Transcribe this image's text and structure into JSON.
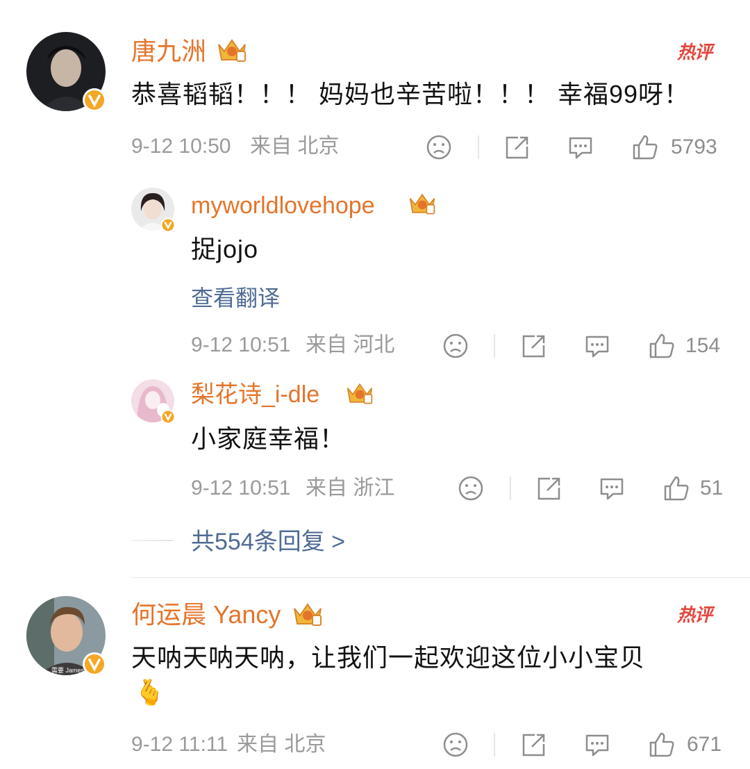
{
  "comments": [
    {
      "username": "唐九洲",
      "text": "恭喜韬韬！！！ 妈妈也辛苦啦！！！ 幸福99呀！",
      "time": "9-12 10:50",
      "location": "来自 北京",
      "likes": "5793",
      "hot_badge": "热评",
      "replies": [
        {
          "username": "myworldlovehope",
          "text": "捉jojo",
          "translate_label": "查看翻译",
          "time": "9-12 10:51",
          "location": "来自 河北",
          "likes": "154"
        },
        {
          "username": "梨花诗_i-dle",
          "text": "小家庭幸福！",
          "time": "9-12 10:51",
          "location": "来自 浙江",
          "likes": "51"
        }
      ],
      "more_replies": "共554条回复 >"
    },
    {
      "username": "何运晨 Yancy",
      "text": "天呐天呐天呐，让我们一起欢迎这位小小宝贝",
      "emoji": "🫰",
      "avatar_caption": "需要 James",
      "time": "9-12 11:11",
      "location": "来自 北京",
      "likes": "671",
      "hot_badge": "热评"
    }
  ],
  "icons": [
    "sad-face-icon",
    "share-icon",
    "comment-icon",
    "like-icon",
    "crown-badge-icon",
    "verified-v-icon"
  ],
  "colors": {
    "username": "#e5742a",
    "link": "#4f6b95",
    "meta": "#9a9a9a",
    "hot": "#e2473d",
    "verified": "#f5a623"
  }
}
